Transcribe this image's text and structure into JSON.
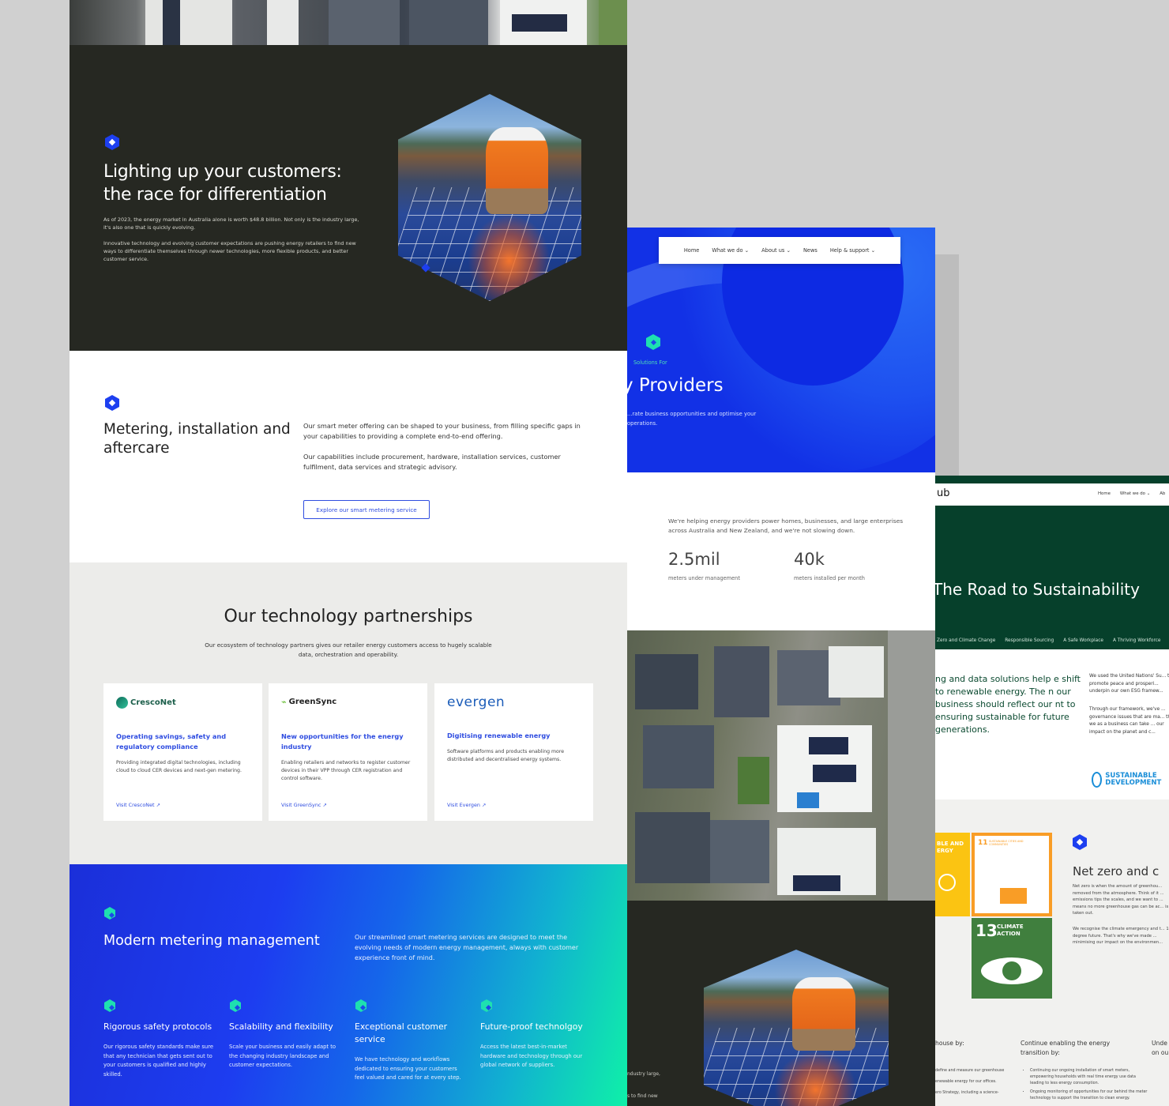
{
  "colors": {
    "dark_bg": "#262822",
    "brand_blue": "#1d3ff0",
    "accent_teal": "#1ee0b0",
    "forest_green": "#06402b",
    "partners_bg": "#ececea"
  },
  "main": {
    "hero": {
      "title": "Lighting up your customers: the race for differentiation",
      "paragraph1": "As of 2023, the energy market in Australia alone is worth $48.8 billion. Not only is the industry large, it's also one that is quickly evolving.",
      "paragraph2": "Innovative technology and evolving customer expectations are pushing energy retailers to find new ways to differentiate themselves through newer technologies, more flexible products, and better customer service."
    },
    "metering": {
      "title": "Metering, installation and aftercare",
      "paragraph1": "Our smart meter offering can be shaped to your business, from filling specific gaps in your capabilities to providing a complete end-to-end offering.",
      "paragraph2": "Our capabilities include procurement, hardware, installation services, customer fulfilment, data services and strategic advisory.",
      "button": "Explore our smart metering service"
    },
    "partnerships": {
      "title": "Our technology partnerships",
      "subtitle": "Our ecosystem of technology partners gives our retailer energy customers access to hugely scalable data, orchestration and operability.",
      "cards": [
        {
          "logo": "CrescoNet",
          "heading": "Operating savings, safety and regulatory compliance",
          "body": "Providing integrated digital technologies, including cloud to cloud CER devices and next-gen metering.",
          "link": "Visit CrescoNet"
        },
        {
          "logo": "GreenSync",
          "heading": "New opportunities for the energy industry",
          "body": "Enabling retailers and networks to register customer devices in their VPP through CER registration and control software.",
          "link": "Visit GreenSync"
        },
        {
          "logo": "evergen",
          "heading": "Digitising renewable energy",
          "body": "Software platforms and products enabling more distributed and decentralised energy systems.",
          "link": "Visit Evergen"
        }
      ],
      "link_icon": "arrow-up-right-icon"
    },
    "modern": {
      "title": "Modern metering management",
      "intro": "Our streamlined smart metering services are designed to meet the evolving needs of modern energy management, always with customer experience front of mind.",
      "features": [
        {
          "title": "Rigorous safety protocols",
          "body": "Our rigorous safety standards make sure that any technician that gets sent out to your customers is qualified and highly skilled."
        },
        {
          "title": "Scalability and flexibility",
          "body": "Scale your business and easily adapt to the changing industry landscape and customer expectations."
        },
        {
          "title": "Exceptional customer service",
          "body": "We have technology and workflows dedicated to ensuring your customers feel valued and cared for at every step."
        },
        {
          "title": "Future-proof technolgoy",
          "body": "Access the latest best-in-market hardware and technology through our global network of suppliers."
        }
      ]
    }
  },
  "mid": {
    "nav": [
      "Home",
      "What we do",
      "About us",
      "News",
      "Help & support"
    ],
    "nav_dropdown_icon": "chevron-down-icon",
    "hero": {
      "tag": "Solutions For",
      "title": "y Providers",
      "desc": "...rate business opportunities and optimise your operations."
    },
    "stats": {
      "lead": "We're helping energy providers power homes, businesses, and large enterprises across Australia and New Zealand, and we're not slowing down.",
      "items": [
        {
          "value": "2.5mil",
          "label": "meters under management"
        },
        {
          "value": "40k",
          "label": "meters installed per month"
        }
      ]
    },
    "dark_snippet": {
      "line1": "ndustry large,",
      "line2": "s to find new"
    }
  },
  "right": {
    "brand": "ub",
    "nav": [
      "Home",
      "What we do",
      "Ab"
    ],
    "hero": {
      "title": "The Road to Sustainability",
      "tabs": [
        "Zero and Climate Change",
        "Responsible Sourcing",
        "A Safe Workplace",
        "A Thriving Workforce"
      ]
    },
    "intro": {
      "big": "ng and data solutions help e shift to renewable energy. The n our business should reflect our nt to ensuring sustainable for future generations.",
      "small1": "We used the United Nations' Su... to promote peace and prosperi... underpin our own ESG framew...",
      "small2": "Through our framework, we've ... governance issues that are ma... that we as a business can take ... our impact on the planet and c...",
      "un_logo": "SUSTAINABLE DEVELOPMENT"
    },
    "sdg": {
      "tile_left_text": "BLE AND ERGY",
      "tile11_number": "11",
      "tile11_label": "SUSTAINABLE CITIES AND COMMUNITIES",
      "tile13_number": "13",
      "tile13_label": "CLIMATE ACTION",
      "title": "Net zero and c",
      "para1": "Net zero is when the amount of greenhou... removed from the atmosphere. Think of it ... emissions tips the scales, and we want to ... means no more greenhouse gas can be ac... is taken out.",
      "para2": "We recognise the climate emergency and t... 1.5-degree future. That's why we've made ... minimising our impact on the environmen...",
      "col1": "house by:",
      "col2": "Continue enabling the energy transition by:",
      "col3": "Unde on ou",
      "col2_items": [
        "Continuing our ongoing installation of smart meters, empowering households with real time energy use data leading to less energy consumption.",
        "Ongoing monitoring of opportunities for our behind the meter technology to support the transition to clean energy."
      ],
      "col1_items": [
        "define and measure our greenhouse",
        "enewable energy for our offices.",
        "ero Strategy, including a science-"
      ]
    }
  }
}
